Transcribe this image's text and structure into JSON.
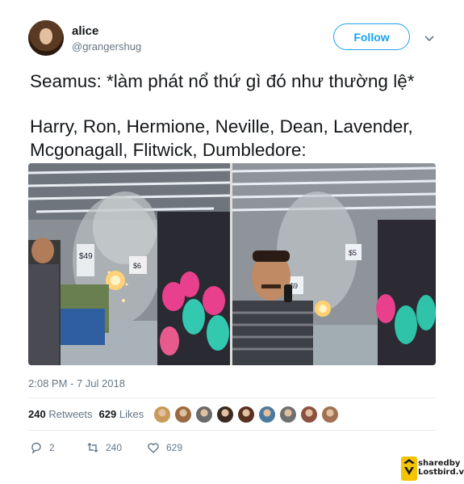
{
  "user": {
    "name": "alice",
    "handle": "@grangershug",
    "avatar": "user-avatar"
  },
  "follow_button": {
    "label": "Follow"
  },
  "tweet": {
    "lines": [
      "Seamus: *làm phát nổ thứ gì đó như thường lệ*",
      "Harry, Ron, Hermione, Neville, Dean, Lavender,",
      "Mcgonagall, Flitwick, Dumbledore:"
    ],
    "timestamp": "2:08 PM - 7 Jul 2018"
  },
  "media": {
    "panel_left": {
      "price_tag_1": "$49",
      "price_tag_2": "$6"
    },
    "panel_right": {
      "price_tag_1": "$9",
      "price_tag_2": "$5"
    }
  },
  "stats": {
    "retweets_count": "240",
    "retweets_label": "Retweets",
    "likes_count": "629",
    "likes_label": "Likes"
  },
  "likers": [
    "#c99a5a",
    "#9a6a40",
    "#6b6b6b",
    "#3a2a20",
    "#5a3020",
    "#4a7aa0",
    "#707070",
    "#8a5040",
    "#a07050"
  ],
  "actions": {
    "reply_count": "2",
    "retweet_count": "240",
    "like_count": "629"
  },
  "watermark": {
    "line1": "sharedby",
    "line2": "Lostbird.vn"
  },
  "colors": {
    "accent": "#1da1f2",
    "secondary_text": "#657786",
    "text": "#14171a",
    "divider": "#e6ecf0"
  }
}
